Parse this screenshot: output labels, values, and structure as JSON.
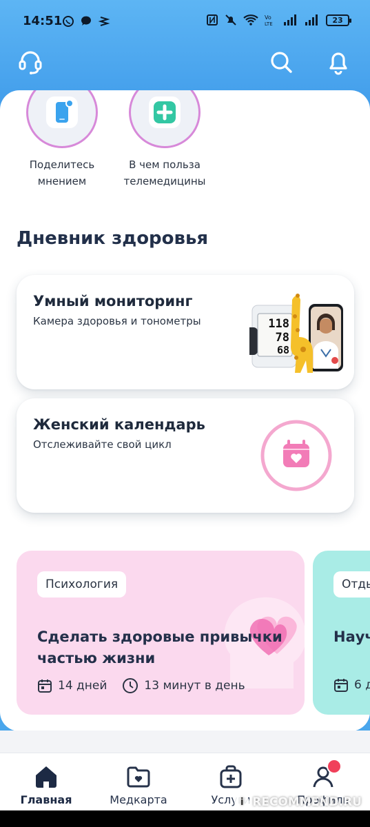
{
  "status_bar": {
    "time": "14:51",
    "battery": "23",
    "icons_left": [
      "whatsapp-icon",
      "chat-icon",
      "app-icon"
    ],
    "icons_right": [
      "nfc-icon",
      "mute-icon",
      "wifi-icon",
      "volte-icon",
      "signal-icon",
      "signal-icon",
      "battery-icon"
    ]
  },
  "header": {
    "icons": [
      "support-headset-icon",
      "search-icon",
      "bell-icon"
    ]
  },
  "stories": [
    {
      "label_line1": "Поделитесь",
      "label_line2": "мнением",
      "icon": "phone-feedback-icon"
    },
    {
      "label_line1": "В чем польза",
      "label_line2": "телемедицины",
      "icon": "medical-plus-icon"
    }
  ],
  "health_diary": {
    "title": "Дневник здоровья",
    "cards": [
      {
        "title": "Умный мониторинг",
        "subtitle": "Камера здоровья и тонометры",
        "display_values": [
          "118",
          "78",
          "68"
        ]
      },
      {
        "title": "Женский календарь",
        "subtitle": "Отслеживайте свой цикл",
        "icon": "calendar-heart-icon"
      }
    ]
  },
  "promos": [
    {
      "tag": "Психология",
      "title": "Сделать здоровые привычки частью жизни",
      "duration": "14 дней",
      "time_per_day": "13 минут в день",
      "bg": "#fbd9ee"
    },
    {
      "tag": "Отды",
      "title": "Науч",
      "duration": "6 д",
      "bg": "#a9ece6"
    }
  ],
  "bottom_nav": [
    {
      "label": "Главная",
      "icon": "home-icon",
      "active": true
    },
    {
      "label": "Медкарта",
      "icon": "medical-folder-icon",
      "active": false
    },
    {
      "label": "Услуги",
      "icon": "medical-bag-icon",
      "active": false
    },
    {
      "label": "Профиль",
      "icon": "profile-icon",
      "active": false,
      "badge": true
    }
  ],
  "watermark": {
    "text": "RECOMMEND.RU",
    "logo": "i"
  },
  "colors": {
    "accent_blue": "#3f9bea",
    "pink": "#f07ab8",
    "story_ring": "#d789d9"
  }
}
